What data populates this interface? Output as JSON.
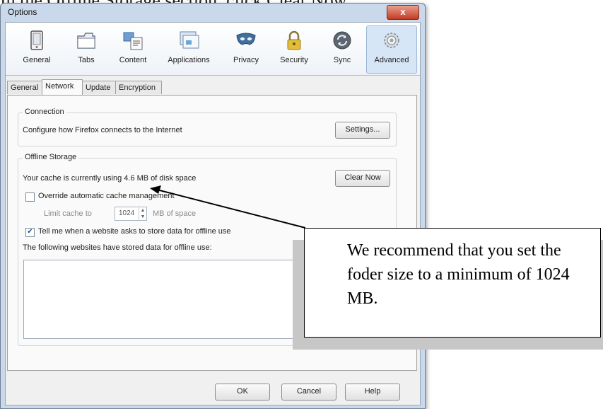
{
  "doc_text": "In the Offline Storage section, click Clear Now.",
  "window": {
    "title": "Options",
    "close_label": "x"
  },
  "toolbar": {
    "items": [
      {
        "label": "General",
        "icon": "general-icon"
      },
      {
        "label": "Tabs",
        "icon": "tabs-icon"
      },
      {
        "label": "Content",
        "icon": "content-icon"
      },
      {
        "label": "Applications",
        "icon": "applications-icon"
      },
      {
        "label": "Privacy",
        "icon": "privacy-icon"
      },
      {
        "label": "Security",
        "icon": "security-icon"
      },
      {
        "label": "Sync",
        "icon": "sync-icon"
      },
      {
        "label": "Advanced",
        "icon": "advanced-icon",
        "selected": true
      }
    ]
  },
  "subtabs": {
    "items": [
      {
        "label": "General"
      },
      {
        "label": "Network",
        "active": true
      },
      {
        "label": "Update"
      },
      {
        "label": "Encryption"
      }
    ]
  },
  "connection": {
    "title": "Connection",
    "description": "Configure how Firefox connects to the Internet",
    "settings_button": "Settings..."
  },
  "offline_storage": {
    "title": "Offline Storage",
    "cache_text": "Your cache is currently using 4.6 MB of disk space",
    "clear_now_button": "Clear Now",
    "override_label": "Override automatic cache management",
    "override_checked": false,
    "limit_label": "Limit cache to",
    "limit_value": "1024",
    "limit_unit": "MB of space",
    "tell_me_label": "Tell me when a website asks to store data for offline use",
    "tell_me_checked": true,
    "following_label": "The following websites have stored data for offline use:"
  },
  "footer": {
    "ok": "OK",
    "cancel": "Cancel",
    "help": "Help"
  },
  "callout": {
    "text": "We recommend that you set the foder size to a minimum of 1024 MB."
  },
  "colors": {
    "window_frame": "#c9d8ea",
    "close_red": "#c43b24",
    "selected_tool": "#d7e6f7"
  }
}
